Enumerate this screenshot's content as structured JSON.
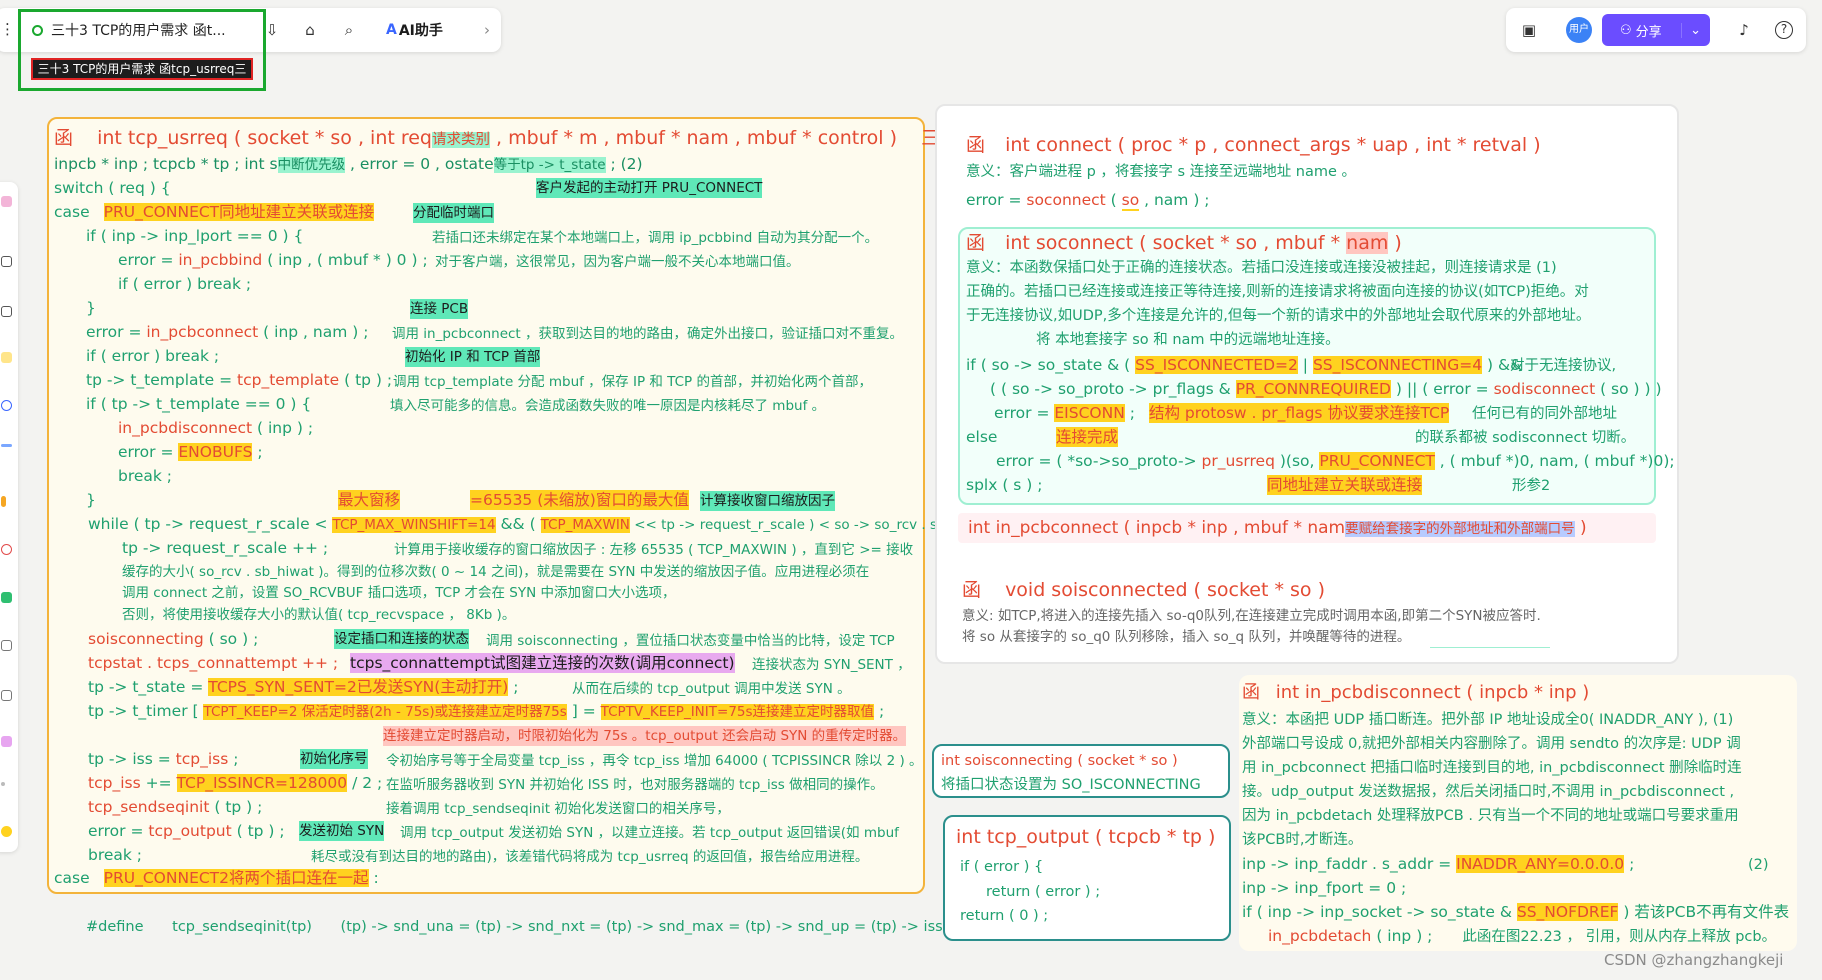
{
  "toolbar": {
    "doc_tab": "三十3 TCP的用户需求 函t...",
    "tooltip": "三十3 TCP的用户需求 函tcp_usrreq三",
    "ai_label": "AI助手",
    "share_label": "分享",
    "avatar_text": "用户",
    "accent": "#6b4dff",
    "highlight_box": "#1aa82f"
  },
  "left_card": {
    "l1_fn": "函",
    "l1_code": "int  tcp_usrreq ( socket * so ,  int  req",
    "l1_hl": "请求类别",
    "l1_rest": " , mbuf * m ,  mbuf * nam , mbuf *  control )",
    "l1_end": "三",
    "l2": "inpcb * inp ;       tcpcb * tp ;       int  s",
    "l2_s": "中断优先级",
    "l2_b": " , error  =  0 , ostate",
    "l2_hl": "等于tp -> t_state",
    "l2_c": " ;                 (2)",
    "l3": "switch ( req ) {",
    "l3_hl": "客户发起的主动打开 PRU_CONNECT",
    "l4_a": "case",
    "l4_hl": "PRU_CONNECT",
    "l4_b": "同地址建立关联或连接",
    "l4_c": "分配临时端口",
    "l5": "if ( inp -> inp_lport  ==  0 ) {",
    "l5_n": "若插口还未绑定在某个本地端口上，调用 ip_pcbbind 自动为其分配一个。",
    "l6": "error  =  ",
    "l6_r": "in_pcbbind",
    "l6_b": " ( inp , ( mbuf * ) 0 ) ;",
    "l6_n": "对于客户端，这很常见，因为客户端一般不关心本地端口值。",
    "l7": "if ( error )       break ;",
    "l8": "}",
    "l8_hl": "连接 PCB",
    "l9": "error  =  ",
    "l9_r": "in_pcbconnect",
    "l9_b": " ( inp , nam ) ;",
    "l9_n": "调用 in_pcbconnect ，获取到达目的地的路由，确定外出接口，验证插口对不重复。",
    "l10": "if ( error )      break ;",
    "l10_hl": "初始化 IP 和 TCP 首部",
    "l11": "tp -> t_template  =  ",
    "l11_r": "tcp_template",
    "l11_b": " ( tp ) ;",
    "l11_n": "调用 tcp_template 分配 mbuf ，保存 IP 和 TCP 的首部，并初始化两个首部，",
    "l12": "if ( tp -> t_template  ==  0 ) {",
    "l12_n": "填入尽可能多的信息。会造成函数失败的唯一原因是内核耗尽了 mbuf 。",
    "l13_r": "in_pcbdisconnect",
    "l13_b": " ( inp ) ;",
    "l14": "error  =  ",
    "l14_hl": "ENOBUFS",
    "l14_b": " ;",
    "l15": "break ;",
    "l16": "}",
    "l16_hl1": "最大窗移",
    "l16_hl2": "=65535  (未缩放)窗口的最大值",
    "l16_hl3": "计算接收窗口缩放因子",
    "l17": "while ( tp -> request_r_scale  <  ",
    "l17_hl": "TCP_MAX_WINSHIFT=14",
    "l17_b": "  &&  ( ",
    "l17_hl2": "TCP_MAXWIN",
    "l17_c": "  <<  tp -> request_r_scale )  <  so -> so_rcv . sb_hiwat )",
    "l18": "tp -> request_r_scale ++ ;",
    "l18_n": "计算用于接收缓存的窗口缩放因子 : 左移 65535 ( TCP_MAXWIN ) ，直到它 >= 接收",
    "l19": "缓存的大小( so_rcv . sb_hiwat )。得到的位移次数( 0 ~ 14 之间)，就是需要在 SYN 中发送的缩放因子值。应用进程必须在",
    "l20": "调用 connect 之前，设置 SO_RCVBUF 插口选项，TCP 才会在 SYN 中添加窗口大小选项，",
    "l21": "否则，将使用接收缓存大小的默认值( tcp_recvspace ，  8Kb  )。",
    "l22_r": "soisconnecting",
    "l22_b": " ( so ) ;",
    "l22_hl": "设定插口和连接的状态",
    "l22_n": "调用 soisconnecting ，置位插口状态变量中恰当的比特，设定 TCP",
    "l23_r": "tcpstat . tcps_connattempt ++ ;",
    "l23_hl": "tcps_connattempt试图建立连接的次数(调用connect)",
    "l23_n": "连接状态为 SYN_SENT ，",
    "l24": "tp -> t_state  =  ",
    "l24_hl": "TCPS_SYN_SENT=2已发送SYN(主动打开)",
    "l24_b": " ;",
    "l24_n": "从而在后续的 tcp_output 调用中发送 SYN 。",
    "l25": "tp -> t_timer [ ",
    "l25_hl": "TCPT_KEEP=2 保活定时器(2h - 75s)或连接建立定时器75s",
    "l25_b": " ]  =  ",
    "l25_hl2": "TCPTV_KEEP_INIT=75s连接建立定时器取值",
    "l25_c": " ;",
    "l26_hl": "连接建立定时器启动，时限初始化为 75s 。tcp_output 还会启动 SYN 的重传定时器。",
    "l27": "tp -> iss  =  ",
    "l27_r": "tcp_iss",
    "l27_b": " ;",
    "l27_hl": "初始化序号",
    "l27_n": "令初始序号等于全局变量 tcp_iss ，再令 tcp_iss 增加 64000 ( TCPISSINCR 除以 2 ) 。",
    "l28_r": "tcp_iss",
    "l28_b": " +=  ",
    "l28_hl": "TCP_ISSINCR=128000",
    "l28_c": " / 2 ;",
    "l28_n": "在监听服务器收到 SYN 并初始化 ISS 时，也对服务器端的 tcp_iss 做相同的操作。",
    "l29_r": "tcp_sendseqinit",
    "l29_b": " ( tp ) ;",
    "l29_n": "接着调用 tcp_sendseqinit 初始化发送窗口的相关序号，",
    "l30": "error  =  ",
    "l30_r": "tcp_output",
    "l30_b": " ( tp ) ;",
    "l30_hl": "发送初始 SYN",
    "l30_n": "调用 tcp_output 发送初始 SYN ，以建立连接。若 tcp_output 返回错误(如 mbuf",
    "l31": "break ;",
    "l31_n": "耗尽或没有到达目的地的路由)，该差错代码将成为 tcp_usrreq 的返回值，报告给应用进程。",
    "l32_a": "case",
    "l32_hl": "PRU_CONNECT2",
    "l32_b": "将两个插口连在一起",
    "l32_c": " :"
  },
  "define_line": {
    "a": "#define",
    "b": "tcp_sendseqinit(tp)",
    "c": "(tp) -> snd_una = (tp) -> snd_nxt =  (tp) -> snd_max = (tp) -> snd_up = (tp) -> iss"
  },
  "connect_card": {
    "fn": "函",
    "title": "int  connect ( proc * p , connect_args * uap ,  int * retval )",
    "desc": "意义：客户端进程 p ，将套接字 s 连接至远端地址 name 。",
    "call": "error  =  ",
    "call_r": "soconnect",
    "call_a": " ( ",
    "call_so": "so",
    "call_b": " , nam ) ;"
  },
  "soconnect_card": {
    "fn": "函",
    "title": "int  soconnect ( socket * so ,  mbuf * ",
    "title_nam": "nam",
    "title_end": " )",
    "d1": "意义：本函数保插口处于正确的连接状态。若插口没连接或连接没被挂起，则连接请求是        (1)",
    "d2": "正确的。若插口已经连接或连接正等待连接,则新的连接请求将被面向连接的协议(如TCP)拒绝。对",
    "d3": "于无连接协议,如UDP,多个连接是允许的,但每一个新的请求中的外部地址会取代原来的外部地址。",
    "d4": "将 本地套接字 so 和 nam 中的远端地址连接。",
    "c1": "if ( so -> so_state  &  ( ",
    "c1_hl": "SS_ISCONNECTED=2",
    "c1_sep": " | ",
    "c1_hl2": "SS_ISCONNECTING=4",
    "c1_b": " )  &&",
    "c1_n": "对于无连接协议,",
    "c2_a": "( ( so -> so_proto -> pr_flags  &  ",
    "c2_hl": "PR_CONNREQUIRED",
    "c2_b": " )  ||  ( error  =  ",
    "c2_r": "sodisconnect",
    "c2_c": " ( so ) ) )",
    "c3": "error  =  ",
    "c3_hl": "EISCONN",
    "c3_b": " ;",
    "c3_hl2": "结构 protosw . pr_flags 协议要求连接TCP",
    "c3_n": "任何已有的同外部地址",
    "c4": "else",
    "c4_hl": "连接完成",
    "c4_n": "的联系都被 sodisconnect 切断。",
    "c5": "error  =  ( *so->so_proto-> ",
    "c5_r": "pr_usrreq",
    "c5_b": " )(so, ",
    "c5_hl": "PRU_CONNECT",
    "c5_c": " ,   ( mbuf *)0, nam, ( mbuf *)0);",
    "c6": "splx ( s ) ;",
    "c6_hl": "同地址建立关联或连接",
    "c6_n": "形参2"
  },
  "pcbconnect_line": {
    "a": "int   in_pcbconnect ( inpcb  *  inp  ,  mbuf  *  nam",
    "hl": "要赋给套接字的外部地址和外部端口号",
    "b": " )"
  },
  "soisconnected_card": {
    "fn": "函",
    "title": "void   soisconnected ( socket * so )",
    "d1": "意义: 如TCP,将进入的连接先插入 so-q0队列,在连接建立完成时调用本函,即第二个SYN被应答时.",
    "d2": "将 so 从套接字的 so_q0 队列移除，插入 so_q 队列，并唤醒等待的进程。"
  },
  "soisconnecting_card": {
    "title": "int   soisconnecting ( socket  *  so   )",
    "desc": "将插口状态设置为 SO_ISCONNECTING"
  },
  "tcp_output_card": {
    "title": "int   tcp_output ( tcpcb * tp )",
    "l1": "if ( error ) {",
    "l2": "return  ( error ) ;",
    "l3": "return  ( 0 ) ;"
  },
  "disconnect_card": {
    "fn": "函",
    "title": "int   in_pcbdisconnect ( inpcb  * inp )",
    "d1": "意义：本函把 UDP 插口断连。把外部 IP 地址设成全0( INADDR_ANY ),   (1)",
    "d2": "外部端口号设成 0,就把外部相关内容删除了。调用 sendto 的次序是: UDP 调",
    "d3": "用 in_pcbconnect 把插口临时连接到目的地, in_pcbdisconnect 删除临时连",
    "d4": "接。udp_output 发送数据报，然后关闭插口时,不调用 in_pcbdisconnect ,",
    "d5": "因为 in_pcbdetach 处理释放PCB . 只有当一个不同的地址或端口号要求重用",
    "d6": "该PCB时,才断连。",
    "c1": "inp -> inp_faddr . s_addr  =  ",
    "c1_hl": "INADDR_ANY=0.0.0.0",
    "c1_b": " ;",
    "c1_n": "(2)",
    "c2": "inp -> inp_fport  =  0 ;",
    "c3": "if ( inp -> inp_socket -> so_state  &  ",
    "c3_hl": "SS_NOFDREF",
    "c3_b": " )  若该PCB不再有文件表",
    "c4_r": "in_pcbdetach",
    "c4_b": " ( inp ) ;",
    "c4_n": "此函在图22.23 ，  引用，则从内存上释放 pcb。"
  },
  "watermark": "CSDN @zhangzhangkeji"
}
